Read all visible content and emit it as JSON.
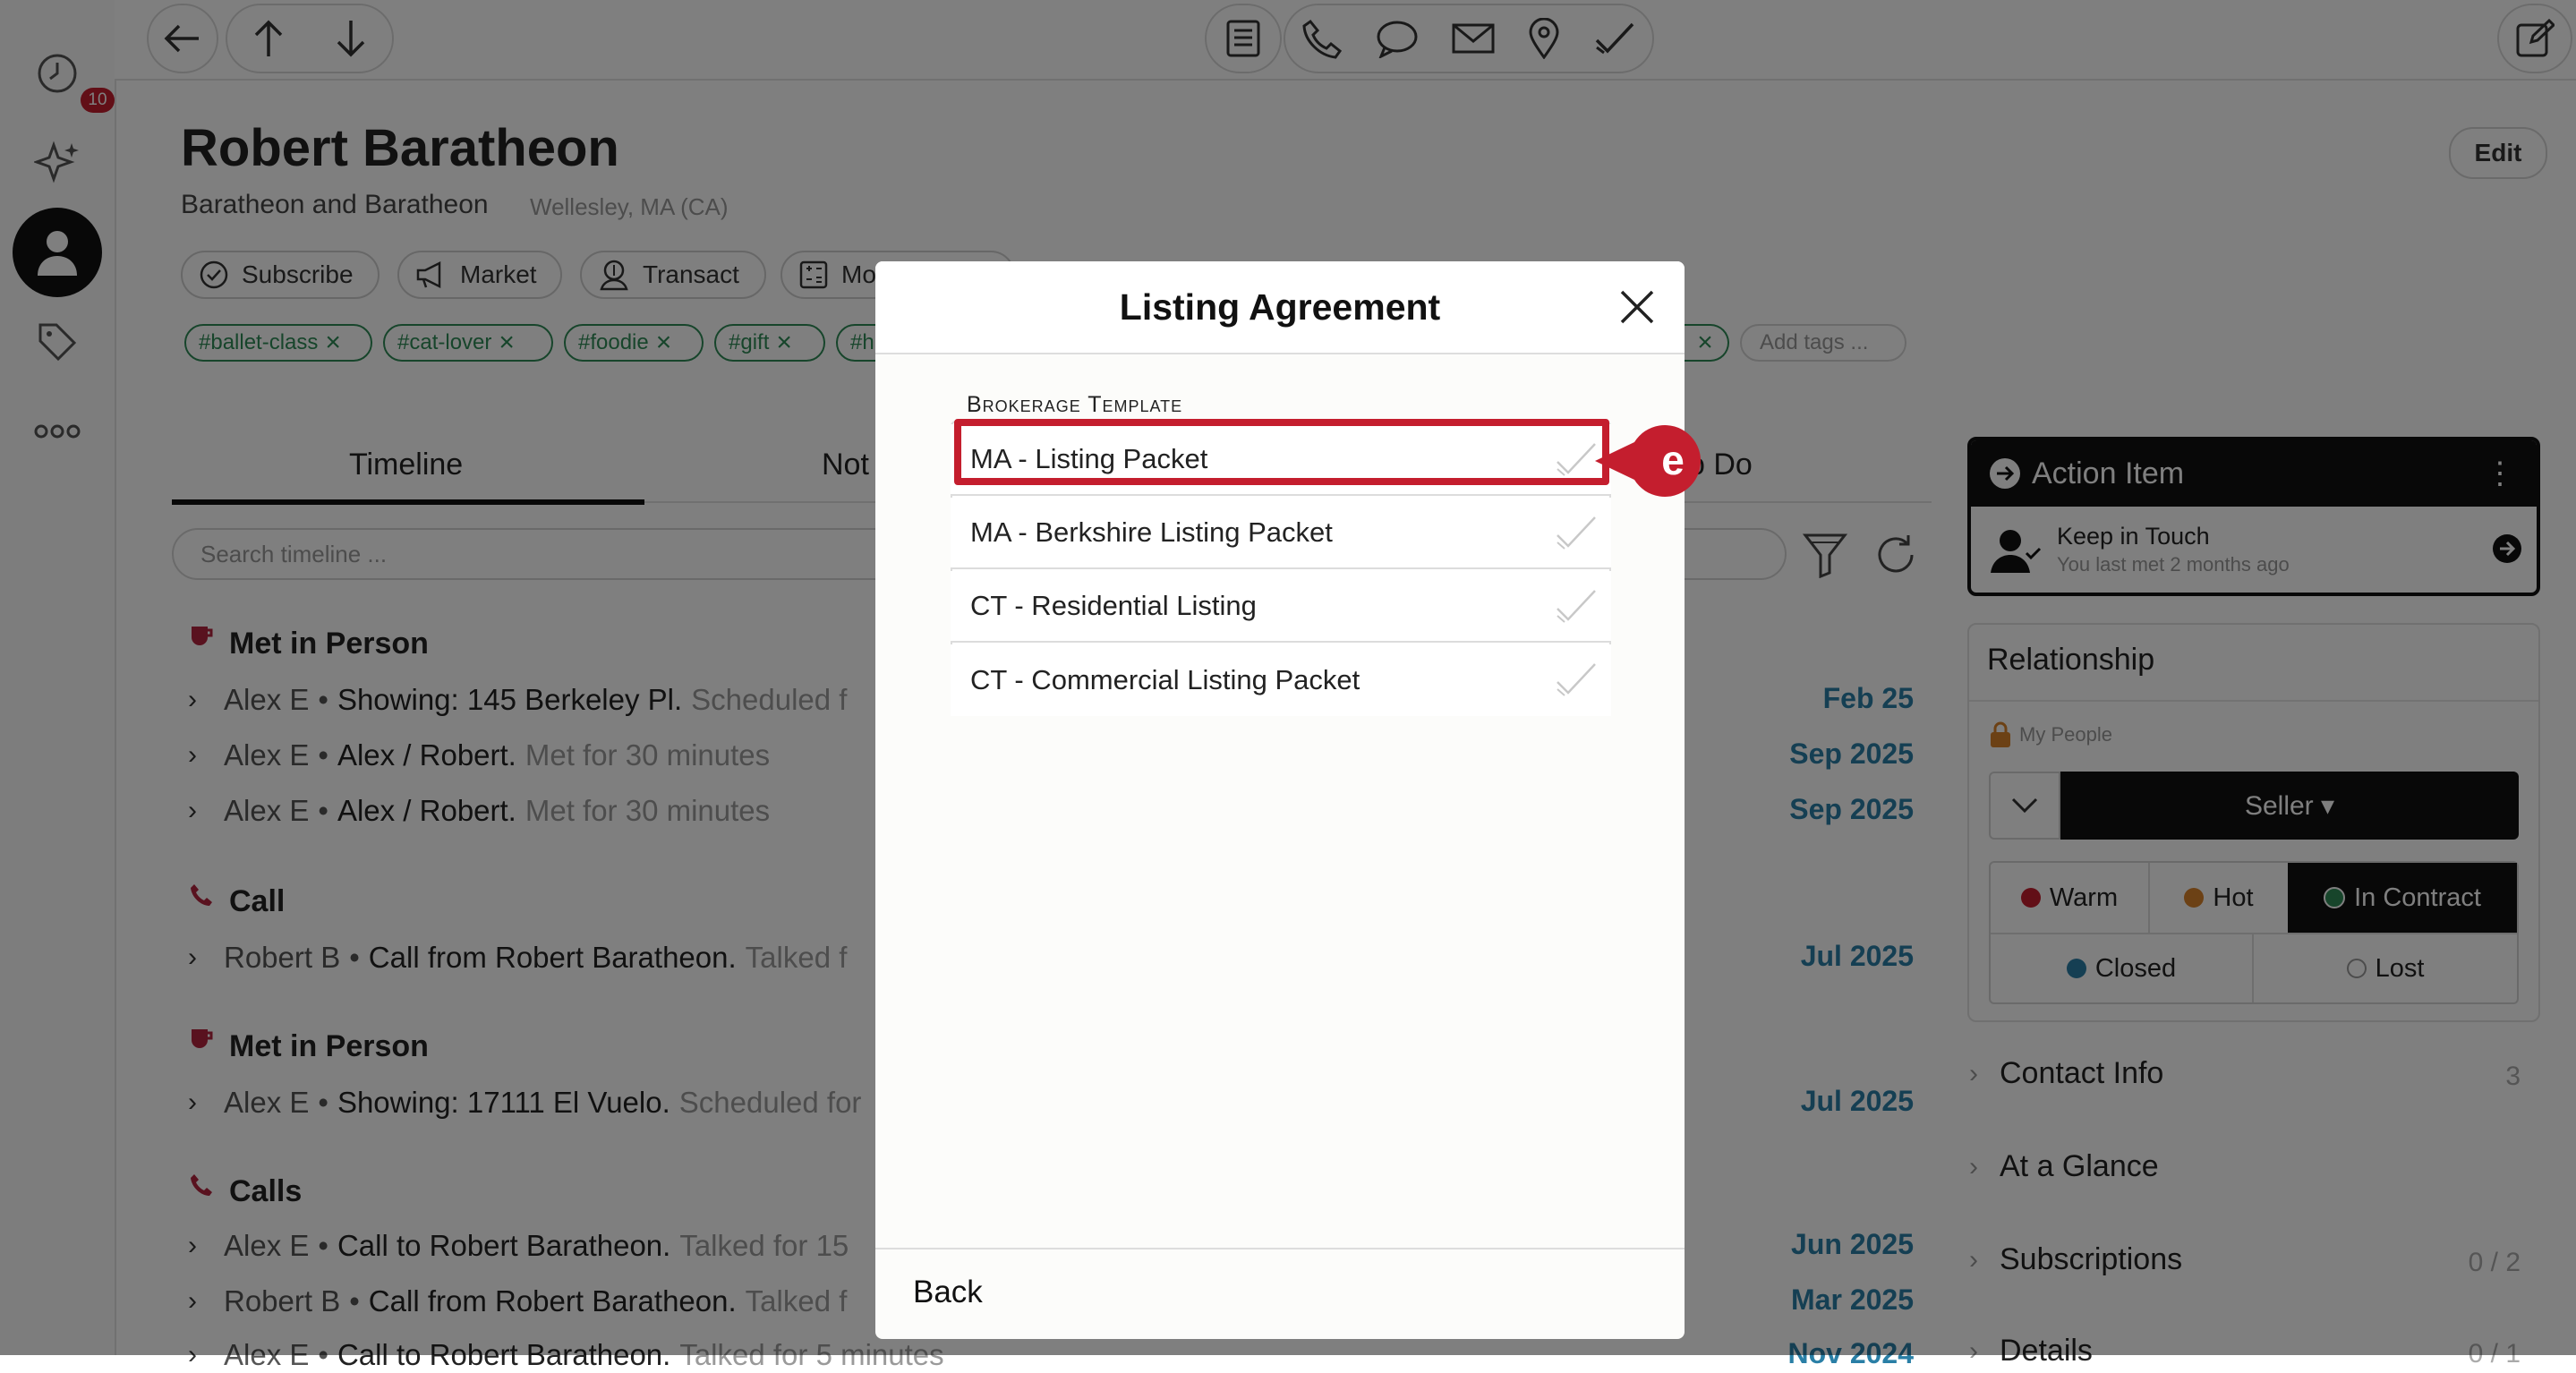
{
  "left_rail": {
    "notification_count": "10",
    "items": [
      "recent-activity-icon",
      "sparkles-icon",
      "contact-person-icon",
      "tag-icon",
      "more-icon"
    ]
  },
  "topbar": {
    "nav": [
      "back-arrow-icon",
      "up-arrow-icon",
      "down-arrow-icon"
    ],
    "actions": [
      "note-icon",
      "phone-icon",
      "chat-icon",
      "email-icon",
      "location-icon",
      "check-icon"
    ],
    "compose": "compose-icon"
  },
  "contact": {
    "name": "Robert Baratheon",
    "company": "Baratheon and Baratheon",
    "location": "Wellesley, MA (CA)",
    "edit_label": "Edit"
  },
  "action_pills": [
    {
      "label": "Subscribe",
      "icon": "check-circle-icon"
    },
    {
      "label": "Market",
      "icon": "megaphone-icon"
    },
    {
      "label": "Transact",
      "icon": "dollar-person-icon"
    },
    {
      "label": "Mo",
      "icon": "calculator-icon"
    }
  ],
  "tags": [
    "#ballet-class",
    "#cat-lover",
    "#foodie",
    "#gift",
    "#h"
  ],
  "add_tags_placeholder": "Add tags ...",
  "tabs": [
    "Timeline",
    "Not",
    "o Do"
  ],
  "search_placeholder": "Search timeline ...",
  "timeline": {
    "sections": [
      {
        "title": "Met in Person",
        "icon": "cup-icon",
        "rows": [
          {
            "who": "Alex E",
            "text": "Showing: 145 Berkeley Pl.",
            "sub": "Scheduled f",
            "date": "Feb 25"
          },
          {
            "who": "Alex E",
            "text": "Alex / Robert.",
            "sub": "Met for 30 minutes",
            "date": "Sep 2025"
          },
          {
            "who": "Alex E",
            "text": "Alex / Robert.",
            "sub": "Met for 30 minutes",
            "date": "Sep 2025"
          }
        ]
      },
      {
        "title": "Call",
        "icon": "phone-icon",
        "rows": [
          {
            "who": "Robert B",
            "text": "Call from Robert Baratheon.",
            "sub": "Talked f",
            "date": "Jul 2025"
          }
        ]
      },
      {
        "title": "Met in Person",
        "icon": "cup-icon",
        "rows": [
          {
            "who": "Alex E",
            "text": "Showing: 17111 El Vuelo.",
            "sub": "Scheduled for",
            "date": "Jul 2025"
          }
        ]
      },
      {
        "title": "Calls",
        "icon": "phone-icon",
        "rows": [
          {
            "who": "Alex E",
            "text": "Call to Robert Baratheon.",
            "sub": "Talked for 15",
            "date": "Jun 2025"
          },
          {
            "who": "Robert B",
            "text": "Call from Robert Baratheon.",
            "sub": "Talked f",
            "date": "Mar 2025"
          },
          {
            "who": "Alex E",
            "text": "Call to Robert Baratheon.",
            "sub": "Talked for 5 minutes",
            "date": "Nov 2024"
          }
        ]
      }
    ]
  },
  "action_item": {
    "title": "Action Item",
    "item_title": "Keep in Touch",
    "item_sub": "You last met 2 months ago"
  },
  "relationship": {
    "title": "Relationship",
    "group": "My People",
    "role": "Seller ▾",
    "stages": [
      "Warm",
      "Hot",
      "In Contract"
    ],
    "stage_colors": [
      "#c41e2e",
      "#d9822b",
      "#2e8b57"
    ],
    "outcomes": [
      "Closed",
      "Lost"
    ]
  },
  "sections_right": [
    {
      "label": "Contact Info",
      "count": "3"
    },
    {
      "label": "At a Glance",
      "count": ""
    },
    {
      "label": "Subscriptions",
      "count": "0 / 2"
    },
    {
      "label": "Details",
      "count": "0 / 1"
    }
  ],
  "modal": {
    "title": "Listing Agreement",
    "section_label": "Brokerage Template",
    "options": [
      "MA - Listing Packet",
      "MA - Berkshire Listing Packet",
      "CT - Residential Listing",
      "CT - Commercial Listing Packet"
    ],
    "selected_index": 0,
    "marker_letter": "e",
    "back_label": "Back"
  },
  "colors": {
    "accent": "#c41e2e",
    "date_blue": "#2a7fa6",
    "tag_green": "#2e8b57"
  }
}
